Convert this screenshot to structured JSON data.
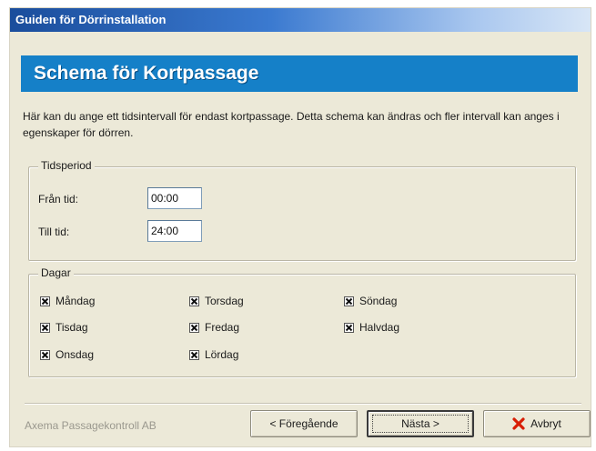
{
  "window": {
    "title": "Guiden för Dörrinstallation"
  },
  "banner": {
    "title": "Schema för Kortpassage"
  },
  "description": "Här kan du ange ett tidsintervall för endast kortpassage. Detta schema kan ändras och fler intervall kan anges i egenskaper för dörren.",
  "tidsperiod": {
    "legend": "Tidsperiod",
    "from_label": "Från tid:",
    "from_value": "00:00",
    "to_label": "Till tid:",
    "to_value": "24:00"
  },
  "dagar": {
    "legend": "Dagar",
    "days": [
      {
        "label": "Måndag",
        "checked": true
      },
      {
        "label": "Tisdag",
        "checked": true
      },
      {
        "label": "Onsdag",
        "checked": true
      },
      {
        "label": "Torsdag",
        "checked": true
      },
      {
        "label": "Fredag",
        "checked": true
      },
      {
        "label": "Lördag",
        "checked": true
      },
      {
        "label": "Söndag",
        "checked": true
      },
      {
        "label": "Halvdag",
        "checked": true
      }
    ]
  },
  "footer": {
    "company": "Axema Passagekontroll AB",
    "prev_label": "< Föregående",
    "next_label": "Nästa >",
    "cancel_label": "Avbryt",
    "cancel_icon": "red-x-icon",
    "cancel_icon_color": "#d81e05"
  },
  "colors": {
    "banner": "#1580c8",
    "window_bg": "#ece9d8"
  }
}
